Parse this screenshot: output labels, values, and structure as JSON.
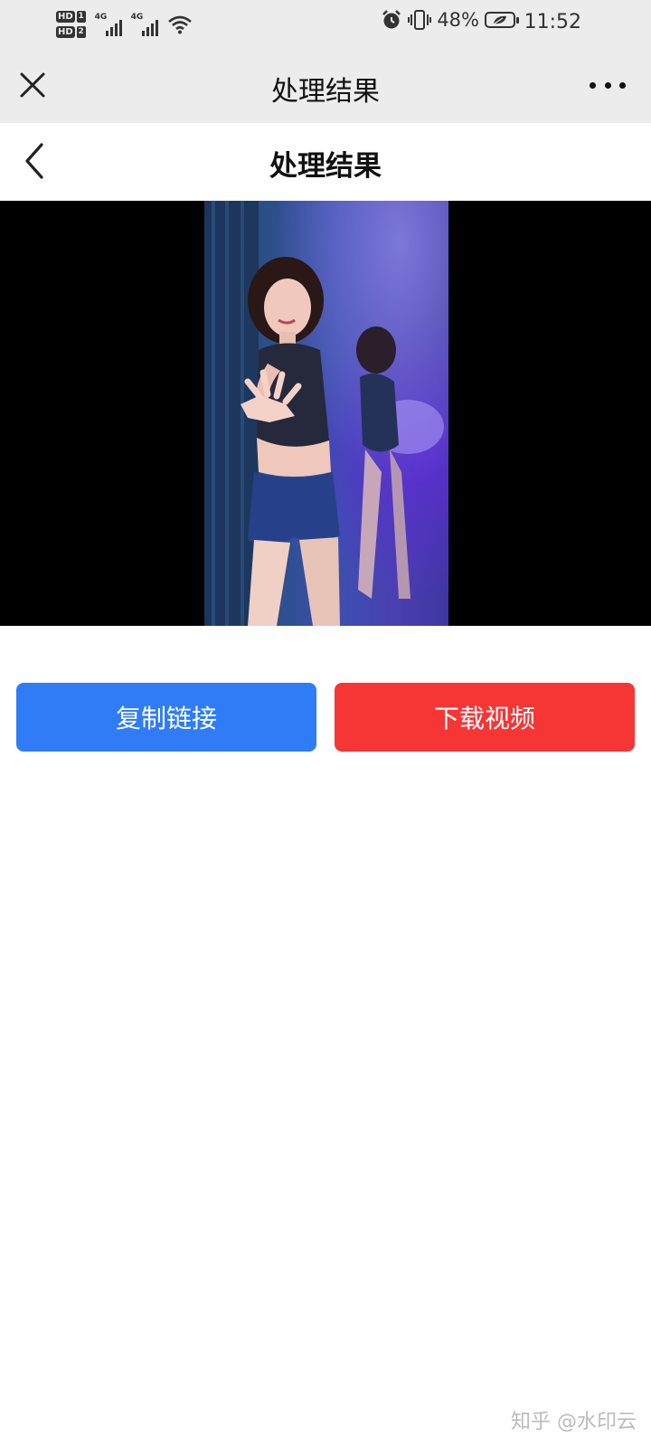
{
  "status_bar": {
    "hd1": "HD",
    "sim1": "1",
    "hd2": "HD",
    "sim2": "2",
    "network1": "4G",
    "network2": "4G",
    "battery_percent": "48%",
    "time": "11:52",
    "icons": [
      "alarm-icon",
      "vibrate-icon",
      "wifi-icon",
      "battery-icon"
    ]
  },
  "topbar": {
    "title": "处理结果",
    "close_icon": "close-icon",
    "more_icon": "more-icon"
  },
  "page_header": {
    "title": "处理结果",
    "back_icon": "chevron-left-icon"
  },
  "actions": {
    "copy_label": "复制链接",
    "download_label": "下载视频",
    "copy_color": "#2f7cf6",
    "download_color": "#f63535"
  },
  "watermark": "知乎 @水印云"
}
